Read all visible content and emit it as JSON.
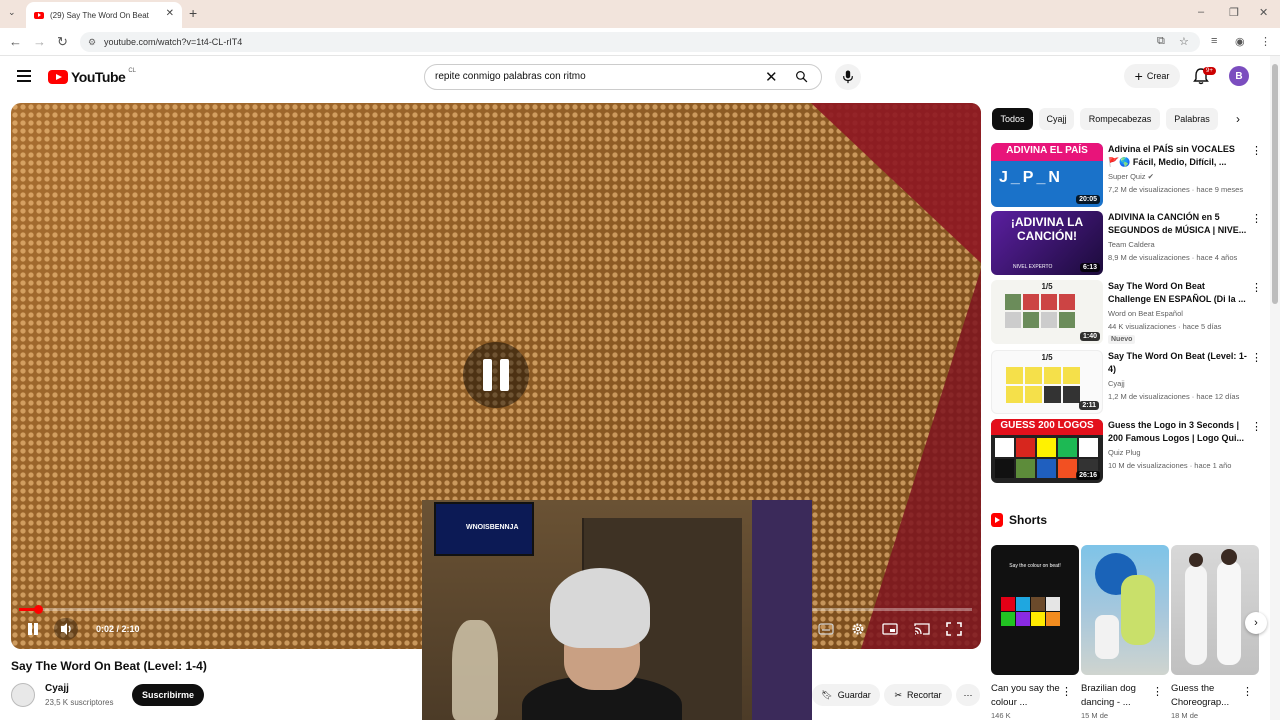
{
  "browser": {
    "tab_title": "(29) Say The Word On Beat",
    "new_tab": "+",
    "url": "youtube.com/watch?v=1t4-CL-rIT4"
  },
  "header": {
    "logo_text": "YouTube",
    "country_code": "CL",
    "search_query": "repite conmigo palabras con ritmo",
    "create_label": "Crear",
    "notification_count": "9+",
    "avatar_letter": "B"
  },
  "player": {
    "current_time": "0:02",
    "duration": "2:10",
    "time_display": "0:02 / 2:10",
    "progress_fraction": 0.02,
    "webcam_tv_text": "WNOISBENNJA"
  },
  "video": {
    "title": "Say The Word On Beat (Level: 1-4)",
    "channel": "Cyajj",
    "subscribers": "23,5 K suscriptores",
    "subscribe_label": "Suscribirme",
    "save_label": "Guardar",
    "clip_label": "Recortar"
  },
  "chips": [
    "Todos",
    "Cyajj",
    "Rompecabezas",
    "Palabras"
  ],
  "recommendations": [
    {
      "title": "Adivina el PAÍS sin VOCALES 🚩🌎 Fácil, Medio, Difícil, ...",
      "channel": "Super Quiz",
      "meta": "7,2 M de visualizaciones · hace 9 meses",
      "duration": "20:05",
      "thumb_text": "ADIVINA EL PAÍS",
      "thumb_sub": "J_P_N"
    },
    {
      "title": "ADIVINA la CANCIÓN en 5 SEGUNDOS de MÚSICA | NIVE...",
      "channel": "Team Caldera",
      "meta": "8,9 M de visualizaciones · hace 4 años",
      "duration": "6:13",
      "thumb_text": "¡ADIVINA LA CANCIÓN!",
      "thumb_sub": "NIVEL EXPERTO"
    },
    {
      "title": "Say The Word On Beat Challenge EN ESPAÑOL (Di la ...",
      "channel": "Word on Beat Español",
      "meta": "44 K visualizaciones · hace 5 días",
      "duration": "1:40",
      "thumb_text": "1/5",
      "badge": "Nuevo"
    },
    {
      "title": "Say The Word On Beat (Level: 1-4)",
      "channel": "Cyajj",
      "meta": "1,2 M de visualizaciones · hace 12 días",
      "duration": "2:11",
      "thumb_text": "1/5"
    },
    {
      "title": "Guess the Logo in 3 Seconds | 200 Famous Logos | Logo Qui...",
      "channel": "Quiz Plug",
      "meta": "10 M de visualizaciones · hace 1 año",
      "duration": "26:16",
      "thumb_text": "GUESS 200 LOGOS"
    }
  ],
  "shorts": {
    "heading": "Shorts",
    "items": [
      {
        "title": "Can you say the colour ...",
        "meta": "146 K",
        "thumb_text": "Say the colour on beat!"
      },
      {
        "title": "Brazilian dog dancing - ...",
        "meta": "15 M de"
      },
      {
        "title": "Guess the Choreograp...",
        "meta": "18 M de"
      }
    ]
  },
  "colors": {
    "brand_red": "#ff0000",
    "chip_active": "#0f0f0f",
    "avatar": "#7b4dbf"
  }
}
